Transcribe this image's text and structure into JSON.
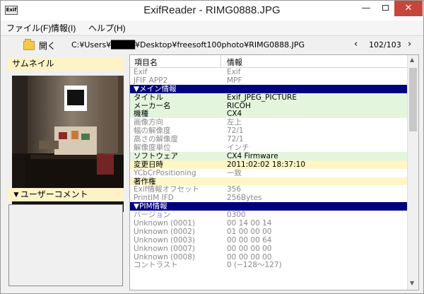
{
  "window": {
    "icon_label": "Exif",
    "title": "ExifReader - RIMG0888.JPG",
    "controls": {
      "minimize": "—",
      "close": "✕"
    }
  },
  "menu": [
    "ファイル(F)",
    "情報(I)",
    "ヘルプ(H)"
  ],
  "toolbar": {
    "open_label": "開く",
    "path": "C:¥Users¥████¥Desktop¥freesoft100photo¥RIMG0888.JPG",
    "prev": "‹",
    "counter": "102/103",
    "next": "›"
  },
  "left": {
    "thumbnail_title": "サムネイル",
    "comment_title": "▼ユーザーコメント"
  },
  "list": {
    "headers": [
      "項目名",
      "情報"
    ],
    "rows": [
      {
        "name": "Exif",
        "value": "Exif",
        "style": "gray"
      },
      {
        "name": "JFIF APP2",
        "value": "MPF",
        "style": "gray"
      },
      {
        "name": "▼メイン情報",
        "value": "",
        "style": "section"
      },
      {
        "name": "タイトル",
        "value": "Exif_JPEG_PICTURE",
        "style": "hl-green"
      },
      {
        "name": "メーカー名",
        "value": "RICOH",
        "style": "hl-green"
      },
      {
        "name": "機種",
        "value": "CX4",
        "style": "hl-green"
      },
      {
        "name": "画像方向",
        "value": "左上",
        "style": "gray"
      },
      {
        "name": "幅の解像度",
        "value": "72/1",
        "style": "gray"
      },
      {
        "name": "高さの解像度",
        "value": "72/1",
        "style": "gray"
      },
      {
        "name": "解像度単位",
        "value": "インチ",
        "style": "gray"
      },
      {
        "name": "ソフトウェア",
        "value": "CX4 Firmware",
        "style": "hl-green"
      },
      {
        "name": "変更日時",
        "value": "2011:02:02 18:37:10",
        "style": "hl-yellow"
      },
      {
        "name": "YCbCrPositioning",
        "value": "一致",
        "style": "gray"
      },
      {
        "name": "著作権",
        "value": "",
        "style": "hl-yellow"
      },
      {
        "name": "Exif情報オフセット",
        "value": "356",
        "style": "gray"
      },
      {
        "name": "PrintIM IFD",
        "value": "256Bytes",
        "style": "gray"
      },
      {
        "name": "▼PIM情報",
        "value": "",
        "style": "section"
      },
      {
        "name": "バージョン",
        "value": "0300",
        "style": "gray"
      },
      {
        "name": "Unknown (0001)",
        "value": "00 14 00 14",
        "style": "gray"
      },
      {
        "name": "Unknown (0002)",
        "value": "01 00 00 00",
        "style": "gray"
      },
      {
        "name": "Unknown (0003)",
        "value": "00 00 00 64",
        "style": "gray"
      },
      {
        "name": "Unknown (0007)",
        "value": "00 00 00 00",
        "style": "gray"
      },
      {
        "name": "Unknown (0008)",
        "value": "00 00 00 00",
        "style": "gray"
      },
      {
        "name": "コントラスト",
        "value": "0 (−128〜127)",
        "style": "gray"
      }
    ]
  }
}
